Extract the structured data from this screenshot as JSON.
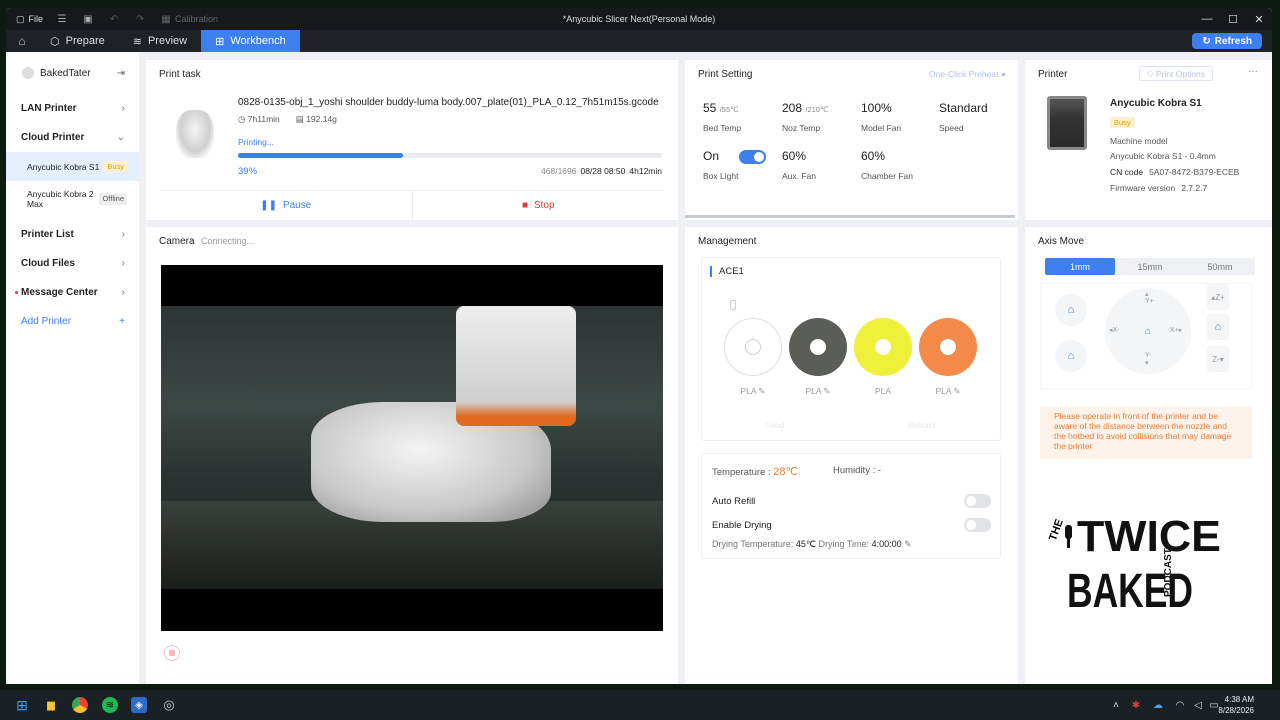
{
  "titlebar": {
    "file_label": "File",
    "calibration_label": "Calibration",
    "window_title": "*Anycubic Slicer Next(Personal Mode)"
  },
  "tabs": [
    {
      "label": "Prepare",
      "icon": "cube-icon"
    },
    {
      "label": "Preview",
      "icon": "layers-icon"
    },
    {
      "label": "Workbench",
      "icon": "grid-icon"
    }
  ],
  "refresh_label": "Refresh",
  "sidebar": {
    "user": "BakedTater",
    "lan_printer": "LAN Printer",
    "cloud_printer": "Cloud Printer",
    "printers": [
      {
        "name": "Anycubic Kobra S1",
        "status": "Busy"
      },
      {
        "name": "Anycubic Kobra 2 Max",
        "status": "Offline"
      }
    ],
    "printer_list": "Printer List",
    "cloud_files": "Cloud Files",
    "message_center": "Message Center",
    "add_printer": "Add Printer"
  },
  "print_task": {
    "header": "Print task",
    "filename": "0828-0135-obj_1_yoshi shoulder buddy-luma body.007_plate(01)_PLA_0.12_7h51m15s.gcode",
    "duration": "7h11min",
    "weight": "192.14g",
    "status": "Printing...",
    "progress_percent": 39,
    "progress_label": "39%",
    "layers": "468/1696",
    "eta": "08/28 08:50",
    "remaining": "4h12min",
    "pause_label": "Pause",
    "stop_label": "Stop"
  },
  "camera": {
    "header": "Camera",
    "status": "Connecting..."
  },
  "print_setting": {
    "header": "Print Setting",
    "preheat_label": "One-Click Preheat",
    "bed_temp": "55",
    "bed_target": "/55℃",
    "bed_label": "Bed Temp",
    "noz_temp": "208",
    "noz_target": "/210℃",
    "noz_label": "Noz Temp",
    "model_fan": "100%",
    "model_fan_label": "Model Fan",
    "speed": "Standard",
    "speed_label": "Speed",
    "box_light": "On",
    "box_light_label": "Box Light",
    "aux_fan": "60%",
    "aux_fan_label": "Aux. Fan",
    "chamber_fan": "60%",
    "chamber_fan_label": "Chamber Fan"
  },
  "printer": {
    "header": "Printer",
    "options_label": "Print Options",
    "name": "Anycubic Kobra S1",
    "status": "Busy",
    "machine_model_label": "Machine model",
    "machine_model": "Anycubic Kobra S1 - 0.4mm",
    "cn_code_label": "CN code",
    "cn_code": "5A07-8472-B379-ECEB",
    "firmware_label": "Firmware version",
    "firmware": "2.7.2.7"
  },
  "management": {
    "header": "Management",
    "ace_label": "ACE1",
    "slots": [
      {
        "material": "PLA",
        "color": "#ffffff"
      },
      {
        "material": "PLA",
        "color": "#5b5d59"
      },
      {
        "material": "PLA",
        "color": "#eef03a"
      },
      {
        "material": "PLA",
        "color": "#f48a4a"
      }
    ],
    "feed_label": "Feed",
    "retract_label": "Retract",
    "temperature_label": "Temperature :",
    "temperature": "28℃",
    "humidity_label": "Humidity :",
    "humidity": "-",
    "auto_refill_label": "Auto Refill",
    "enable_drying_label": "Enable Drying",
    "drying_temp_label": "Drying Temperature:",
    "drying_temp": "45℃",
    "drying_time_label": "Drying Time:",
    "drying_time": "4:00:00"
  },
  "axis_move": {
    "header": "Axis Move",
    "steps": [
      "1mm",
      "15mm",
      "50mm"
    ],
    "warning": "Please operate in front of the printer and be aware of the distance between the nozzle and the hotbed to avoid collisions that may damage the printer",
    "logo": {
      "the": "THE",
      "twice": "TWICE",
      "baked": "BAKED",
      "podcast": "PODCAST"
    }
  },
  "colors": {
    "accent": "#3b7ff0",
    "stop": "#e03838",
    "busy": "#d8a000",
    "warning": "#e77d34"
  },
  "clock": {
    "time": "4:38 AM",
    "date": "8/28/2026"
  }
}
